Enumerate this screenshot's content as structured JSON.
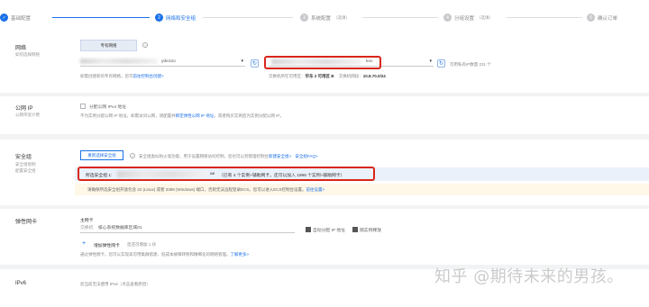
{
  "steps": [
    {
      "num": "✓",
      "label": "基础配置",
      "optional": ""
    },
    {
      "num": "2",
      "label": "网络和安全组",
      "optional": ""
    },
    {
      "num": "3",
      "label": "系统配置",
      "optional": "（选填）"
    },
    {
      "num": "4",
      "label": "分组设置",
      "optional": "（选填）"
    },
    {
      "num": "5",
      "label": "确认订单",
      "optional": ""
    }
  ],
  "network": {
    "title": "网络",
    "subtitle": "如何选择网络",
    "type_button": "专有网络",
    "vpc_suffix": "yde12o",
    "vswitch_suffix": "kov",
    "available_ips": "可用私有IP数量 231 个",
    "vpc_hint": "如需创建新的专有网络，您可",
    "vpc_hint_link": "前往控制台创建>",
    "zone_label": "交换机所在可用区：",
    "zone_value": "华东 2 可用区 B",
    "cidr_label": "交换机网段：",
    "cidr_value": "10.8.70.0/24"
  },
  "public_ip": {
    "title": "公网 IP",
    "subtitle": "公网带宽计费",
    "checkbox_label": "分配公网 IPv4 地址",
    "hint": "不为实例分配公网 IP 地址，如需访问公网，请配置并",
    "hint_link": "绑定弹性公网 IP 地址",
    "hint_tail": "，或者购买实例后为实例分配公网 IP。"
  },
  "security_group": {
    "title": "安全组",
    "subtitle_1": "安全组限制",
    "subtitle_2": "配置安全组",
    "reselect_button": "重新选择安全组",
    "desc": "安全组类似防火墙功能，用于设置网络访问控制，您也可以到管理控制台",
    "desc_link": "新建安全组>",
    "faq": "安全组FAQ>",
    "selected_label": "所选安全组 1:",
    "selected_suffix": "ae",
    "selected_detail": "（已有 4 个实例+辅助网卡，还可以加入 1996 个实例+辅助网卡）",
    "warning": "请确保所选安全组开放包含 22 (Linux) 或者 3389 (Windows) 端口，否则无法远程登录ECS。您可以进入ECS控制台设置。",
    "warning_link": "前往设置>"
  },
  "eni": {
    "title": "弹性网卡",
    "primary_label": "主网卡",
    "vswitch_label": "交换机",
    "vswitch_value": "核心系统数据库区域01",
    "auto_ip": "自动分配 IP 地址",
    "release_with_instance": "随实例释放",
    "add_button": "增加弹性网卡",
    "add_hint": "您还可增加 1 块",
    "desc": "通过弹性网卡，您可以实现高可用集群搭建、低成本故障转移和精细化的网络管理。",
    "desc_link": "了解更多>"
  },
  "ipv6": {
    "title": "IPv6",
    "text": "您当前无法使用 IPv6（点击查看原因）"
  },
  "watermark": "知乎 @期待未来的男孩。",
  "colors": {
    "accent": "#1a70e8",
    "highlight": "#d9261c"
  }
}
